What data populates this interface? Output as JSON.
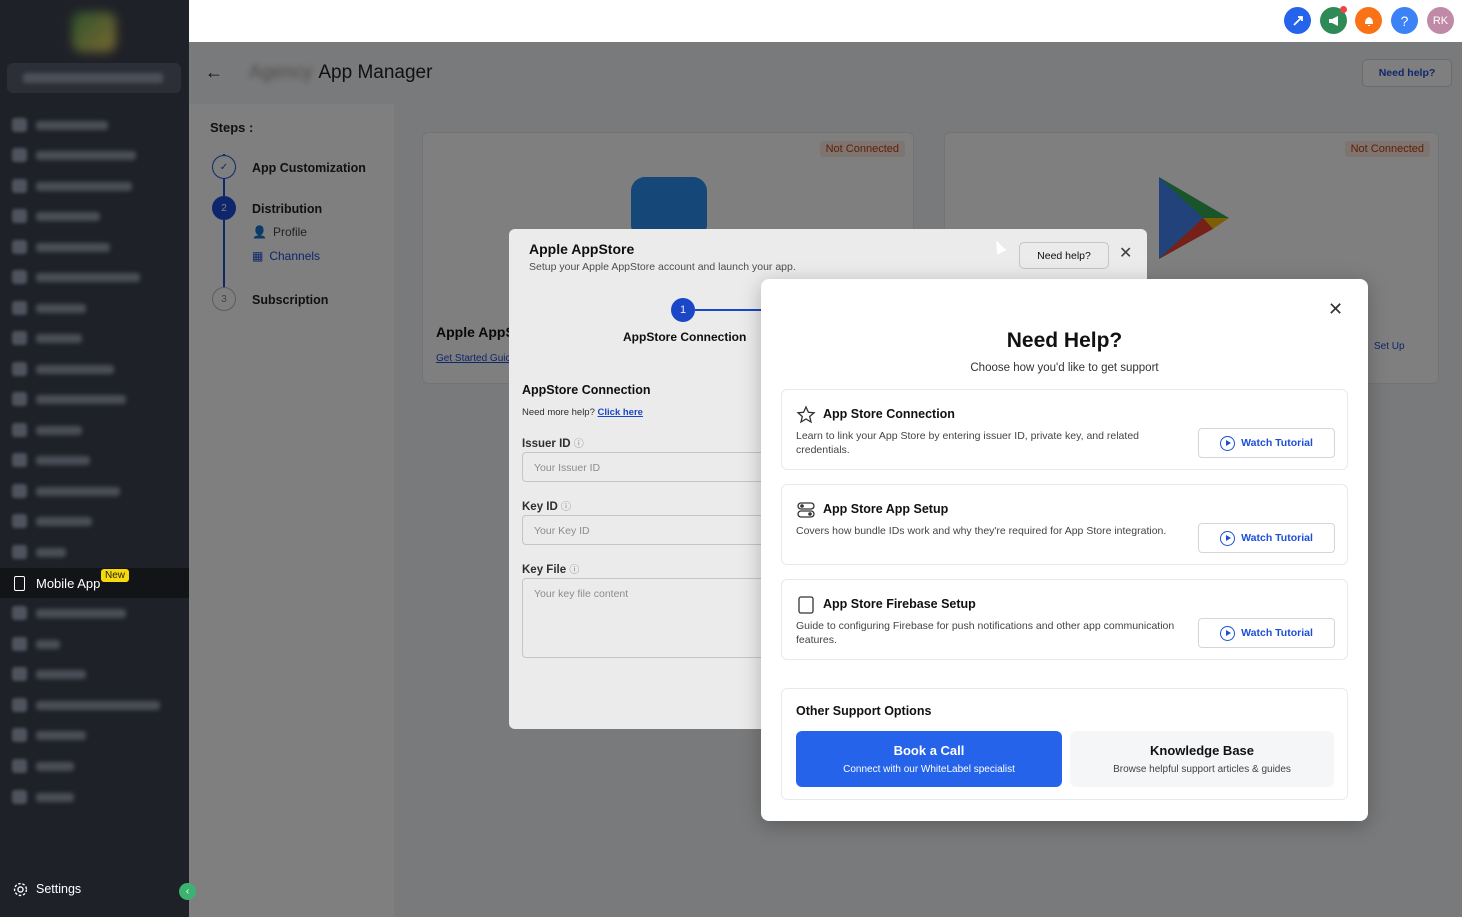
{
  "sidebar": {
    "active_item": {
      "label": "Mobile App",
      "badge": "New"
    },
    "settings_label": "Settings"
  },
  "topbar": {
    "avatar_initials": "RK",
    "help_glyph": "?"
  },
  "page": {
    "title": "App Manager",
    "need_help": "Need help?",
    "steps_label": "Steps :",
    "steps": [
      {
        "num": "",
        "label": "App Customization",
        "state": "done"
      },
      {
        "num": "2",
        "label": "Distribution",
        "state": "active"
      },
      {
        "num": "3",
        "label": "Subscription",
        "state": "pending"
      }
    ],
    "sub_items": {
      "profile": "Profile",
      "channels": "Channels"
    },
    "cards": {
      "apple": {
        "status": "Not Connected",
        "title": "Apple AppS",
        "link": "Get Started Guic"
      },
      "google": {
        "status": "Not Connected",
        "setup": "Set Up"
      }
    }
  },
  "dialog": {
    "title": "Apple AppStore",
    "subtitle": "Setup your Apple AppStore account and launch your app.",
    "need_help": "Need help?",
    "step_num": "1",
    "step_label": "AppStore Connection",
    "section_title": "AppStore Connection",
    "more_help": "Need more help?",
    "click_here": "Click here",
    "issuer_label": "Issuer ID",
    "issuer_placeholder": "Your Issuer ID",
    "key_label": "Key ID",
    "key_placeholder": "Your Key ID",
    "file_label": "Key File",
    "file_placeholder": "Your key file content"
  },
  "help_modal": {
    "title": "Need Help?",
    "subtitle": "Choose how you'd like to get support",
    "options": [
      {
        "title": "App Store Connection",
        "desc": "Learn to link your App Store by entering issuer ID, private key, and related credentials.",
        "button": "Watch Tutorial",
        "icon": "star-icon"
      },
      {
        "title": "App Store App Setup",
        "desc": "Covers how bundle IDs work and why they're required for App Store integration.",
        "button": "Watch Tutorial",
        "icon": "toggle-icon"
      },
      {
        "title": "App Store Firebase Setup",
        "desc": "Guide to configuring Firebase for push notifications and other app communication features.",
        "button": "Watch Tutorial",
        "icon": "square-icon"
      }
    ],
    "other_title": "Other Support Options",
    "book_title": "Book a Call",
    "book_desc": "Connect with our WhiteLabel specialist",
    "kb_title": "Knowledge Base",
    "kb_desc": "Browse helpful support articles & guides"
  },
  "colors": {
    "primary": "#2563eb",
    "sidebar": "#1f2128",
    "badge": "#f5d90a",
    "not_connected": "#c2410c"
  }
}
